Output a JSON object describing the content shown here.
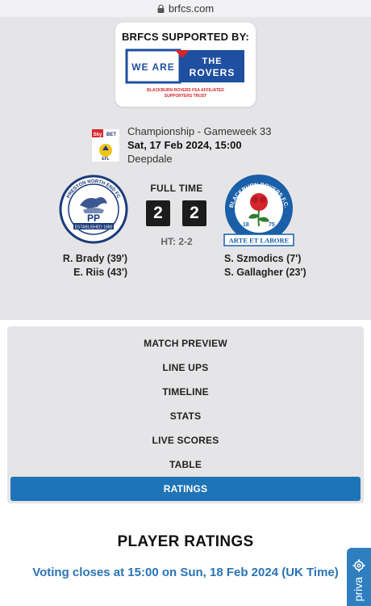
{
  "browser": {
    "url": "brfcs.com"
  },
  "sponsor": {
    "title": "BRFCS SUPPORTED BY:",
    "logo_text_left": "WE ARE",
    "logo_text_right": "THE ROVERS",
    "logo_subtext": "BLACKBURN ROVERS FSA AFFILIATED SUPPORTERS TRUST",
    "colors": {
      "blue": "#1f4fa0",
      "red": "#d4262d"
    }
  },
  "match": {
    "competition": "Championship - Gameweek 33",
    "datetime": "Sat, 17 Feb 2024, 15:00",
    "venue": "Deepdale",
    "competition_badge_text": "Sky BET",
    "competition_badge_sub": "EFL",
    "status": "FULL TIME",
    "home": {
      "score": "2",
      "crest_text": "PP",
      "crest_ring_top": "PRESTON NORTH END FC",
      "crest_ring_bottom": "ESTABLISHED 1880",
      "scorers": [
        "R. Brady (39')",
        "E. Riis (43')"
      ]
    },
    "away": {
      "score": "2",
      "crest_text": "ARTE ET LABORE",
      "crest_ring": "BLACKBURN ROVERS F.C.",
      "crest_years": [
        "18",
        "75"
      ],
      "scorers": [
        "S. Szmodics (7')",
        "S. Gallagher (23')"
      ]
    },
    "half_time": "HT: 2-2"
  },
  "menu": {
    "items": [
      {
        "label": "MATCH PREVIEW"
      },
      {
        "label": "LINE UPS"
      },
      {
        "label": "TIMELINE"
      },
      {
        "label": "STATS"
      },
      {
        "label": "LIVE SCORES"
      },
      {
        "label": "TABLE"
      },
      {
        "label": "RATINGS"
      }
    ],
    "active": "RATINGS",
    "active_color": "#1f74b8"
  },
  "ratings": {
    "title": "PLAYER RATINGS",
    "voting": "Voting closes at 15:00 on Sun, 18 Feb 2024 (UK Time)"
  },
  "privacy_tab": {
    "label": "priva",
    "icon": "gear-icon"
  }
}
